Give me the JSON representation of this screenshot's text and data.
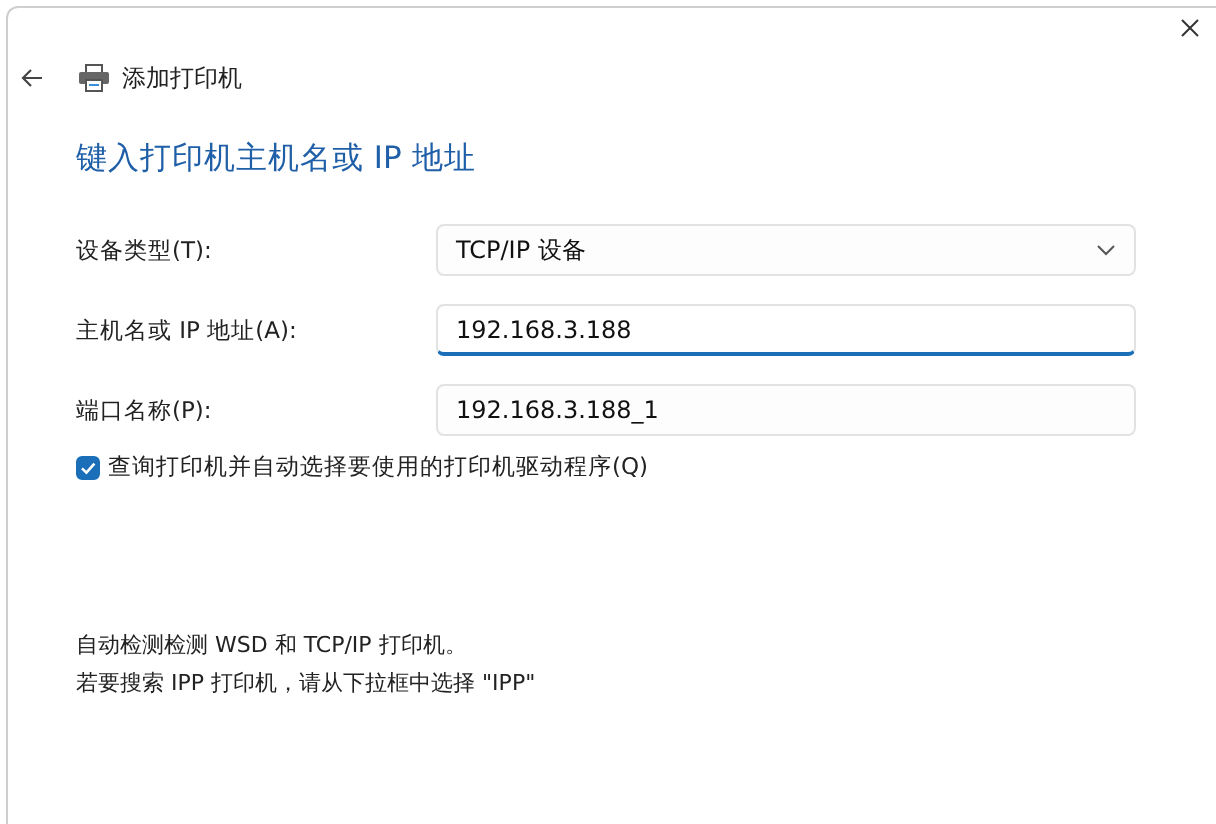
{
  "window": {
    "title": "添加打印机"
  },
  "heading": "键入打印机主机名或 IP 地址",
  "fields": [
    {
      "kind": "dropdown",
      "label": "设备类型(T):",
      "value": "TCP/IP 设备",
      "focused": false
    },
    {
      "kind": "text",
      "label": "主机名或 IP 地址(A):",
      "value": "192.168.3.188",
      "focused": true
    },
    {
      "kind": "text",
      "label": "端口名称(P):",
      "value": "192.168.3.188_1",
      "focused": false
    }
  ],
  "checkbox": {
    "label": "查询打印机并自动选择要使用的打印机驱动程序(Q)",
    "checked": true
  },
  "notes": [
    "自动检测检测 WSD 和 TCP/IP 打印机。",
    "若要搜索 IPP 打印机，请从下拉框中选择 \"IPP\""
  ]
}
